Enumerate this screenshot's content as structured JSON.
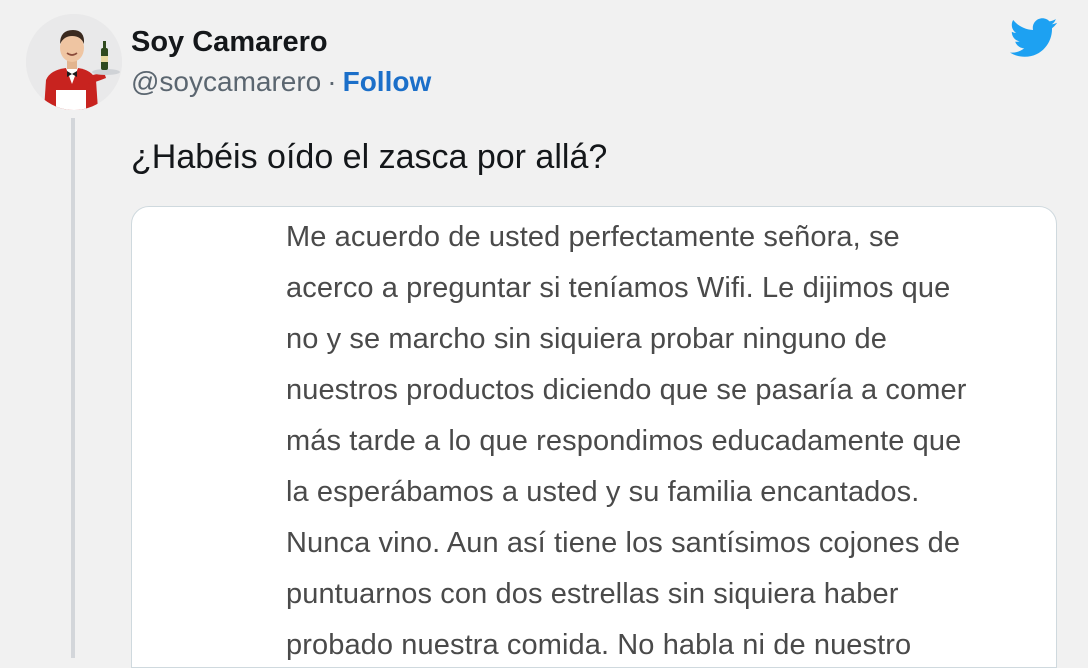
{
  "author": {
    "name": "Soy Camarero",
    "handle": "@soycamarero",
    "separator": "·",
    "follow_label": "Follow"
  },
  "icons": {
    "brand": "twitter-bird-icon",
    "brand_color": "#1da1f2"
  },
  "tweet": {
    "text": "¿Habéis oído el zasca por allá?"
  },
  "media": {
    "lines": [
      "Me acuerdo de usted perfectamente señora, se",
      "acerco a preguntar si teníamos Wifi. Le dijimos que",
      "no y se marcho sin siquiera probar ninguno de",
      "nuestros productos diciendo que se pasaría a comer",
      "más tarde a lo que respondimos educadamente que",
      "la esperábamos a usted y su familia encantados.",
      "Nunca vino. Aun así tiene los santísimos cojones de",
      "puntuarnos con dos estrellas sin siquiera haber",
      "probado nuestra comida. No habla ni de nuestro"
    ]
  }
}
